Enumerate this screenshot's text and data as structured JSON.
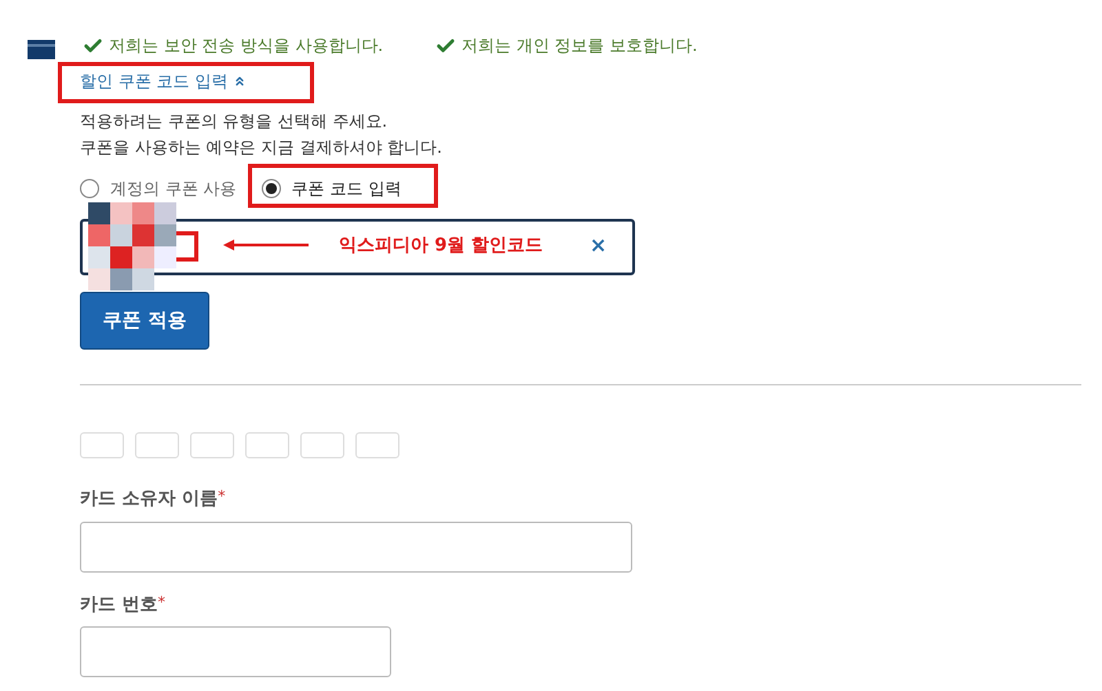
{
  "trust_badges": [
    {
      "text": "저희는 보안 전송 방식을 사용합니다."
    },
    {
      "text": "저희는 개인 정보를 보호합니다."
    }
  ],
  "coupon_toggle": {
    "label": "할인 쿠폰 코드 입력",
    "expanded": true
  },
  "instructions": [
    "적용하려는 쿠폰의 유형을 선택해 주세요.",
    "쿠폰을 사용하는 예약은 지금 결제하셔야 합니다."
  ],
  "coupon_types": [
    {
      "label": "계정의 쿠폰 사용",
      "selected": false
    },
    {
      "label": "쿠폰 코드 입력",
      "selected": true
    }
  ],
  "coupon_field": {
    "annotation": "익스피디아 9월 할인코드",
    "clear": "×"
  },
  "apply_button": "쿠폰 적용",
  "card_fields": [
    {
      "label": "카드 소유자 이름",
      "required_mark": "*",
      "kind": "long"
    },
    {
      "label": "카드 번호",
      "required_mark": "*",
      "kind": "short"
    }
  ]
}
